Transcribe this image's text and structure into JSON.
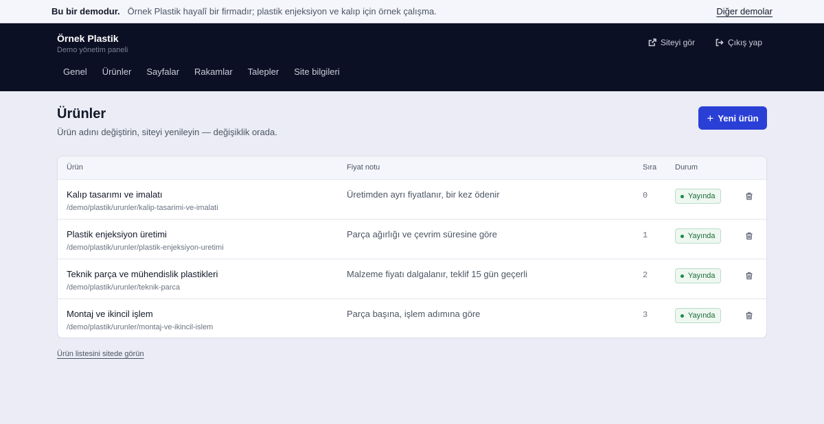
{
  "demo_bar": {
    "label": "Bu bir demodur.",
    "description": "Örnek Plastik hayalî bir firmadır; plastik enjeksiyon ve kalıp için örnek çalışma.",
    "other_demos": "Diğer demolar"
  },
  "header": {
    "brand_name": "Örnek Plastik",
    "brand_sub": "Demo yönetim paneli",
    "view_site": "Siteyi gör",
    "logout": "Çıkış yap",
    "nav": [
      "Genel",
      "Ürünler",
      "Sayfalar",
      "Rakamlar",
      "Talepler",
      "Site bilgileri"
    ]
  },
  "page": {
    "title": "Ürünler",
    "subtitle": "Ürün adını değiştirin, siteyi yenileyin — değişiklik orada.",
    "new_button": "Yeni ürün",
    "footer_link": "Ürün listesini sitede görün"
  },
  "table": {
    "columns": [
      "Ürün",
      "Fiyat notu",
      "Sıra",
      "Durum"
    ],
    "rows": [
      {
        "name": "Kalıp tasarımı ve imalatı",
        "path": "/demo/plastik/urunler/kalip-tasarimi-ve-imalati",
        "note": "Üretimden ayrı fiyatlanır, bir kez ödenir",
        "order": "0",
        "status": "Yayında"
      },
      {
        "name": "Plastik enjeksiyon üretimi",
        "path": "/demo/plastik/urunler/plastik-enjeksiyon-uretimi",
        "note": "Parça ağırlığı ve çevrim süresine göre",
        "order": "1",
        "status": "Yayında"
      },
      {
        "name": "Teknik parça ve mühendislik plastikleri",
        "path": "/demo/plastik/urunler/teknik-parca",
        "note": "Malzeme fiyatı dalgalanır, teklif 15 gün geçerli",
        "order": "2",
        "status": "Yayında"
      },
      {
        "name": "Montaj ve ikincil işlem",
        "path": "/demo/plastik/urunler/montaj-ve-ikincil-islem",
        "note": "Parça başına, işlem adımına göre",
        "order": "3",
        "status": "Yayında"
      }
    ]
  },
  "colors": {
    "header_bg": "#0c1024",
    "accent": "#2a3fd6",
    "status_green": "#1f8a4c"
  },
  "icons": {
    "view_site": "external-link-icon",
    "logout": "logout-icon",
    "new": "plus-icon",
    "delete": "trash-icon"
  }
}
